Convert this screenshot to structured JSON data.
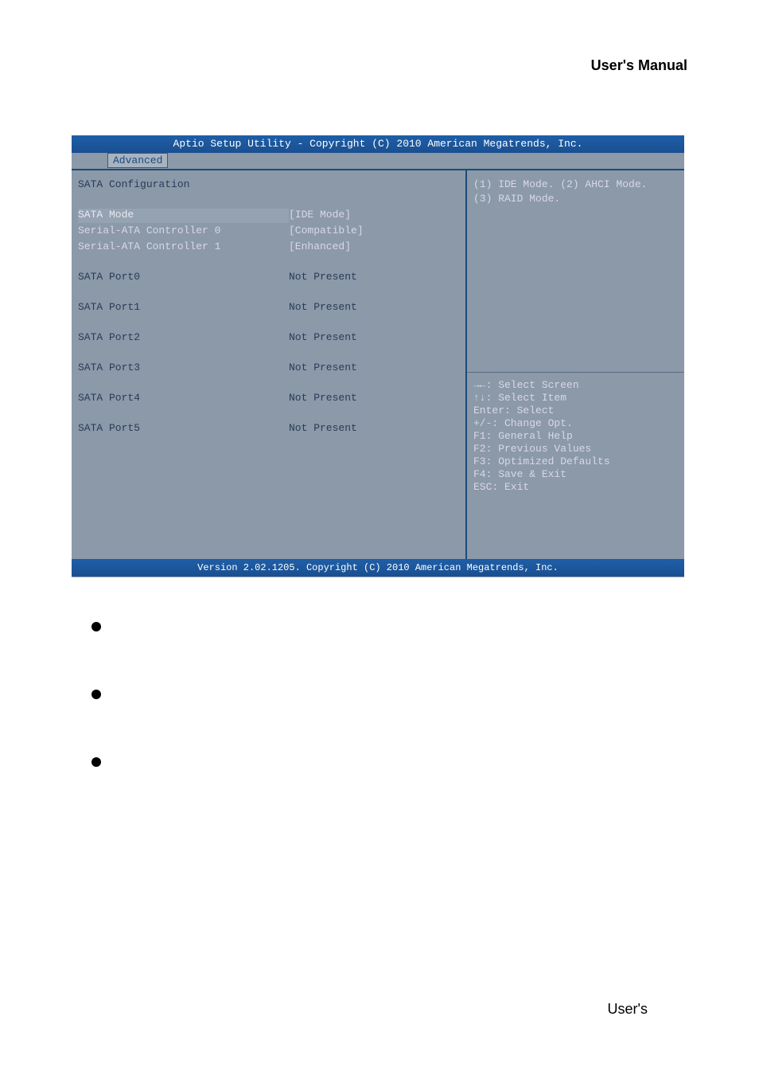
{
  "page": {
    "header_title": "User's  Manual",
    "footer_text": "User's"
  },
  "bios": {
    "header": "Aptio Setup Utility - Copyright (C) 2010 American Megatrends, Inc.",
    "tab": "Advanced",
    "footer": "Version 2.02.1205. Copyright (C) 2010 American Megatrends, Inc.",
    "section_title": "SATA Configuration",
    "items": [
      {
        "label": "SATA Mode",
        "value": "[IDE Mode]",
        "lit_label": true,
        "lit_value": true,
        "sel": true
      },
      {
        "label": "Serial-ATA Controller 0",
        "value": "[Compatible]",
        "lit_label": true,
        "lit_value": true
      },
      {
        "label": "Serial-ATA Controller 1",
        "value": "[Enhanced]",
        "lit_label": true,
        "lit_value": true
      }
    ],
    "ports": [
      {
        "label": "SATA Port0",
        "value": "Not Present"
      },
      {
        "label": "SATA Port1",
        "value": "Not Present"
      },
      {
        "label": "SATA Port2",
        "value": "Not Present"
      },
      {
        "label": "SATA Port3",
        "value": "Not Present"
      },
      {
        "label": "SATA Port4",
        "value": "Not Present"
      },
      {
        "label": "SATA Port5",
        "value": "Not Present"
      }
    ],
    "help": {
      "line1": "(1) IDE Mode. (2) AHCI Mode.",
      "line2": "(3) RAID Mode."
    },
    "nav": [
      "→←: Select Screen",
      "↑↓: Select Item",
      "Enter: Select",
      "+/-: Change Opt.",
      "F1: General Help",
      "F2: Previous Values",
      "F3: Optimized Defaults",
      "F4: Save & Exit",
      "ESC: Exit"
    ]
  }
}
